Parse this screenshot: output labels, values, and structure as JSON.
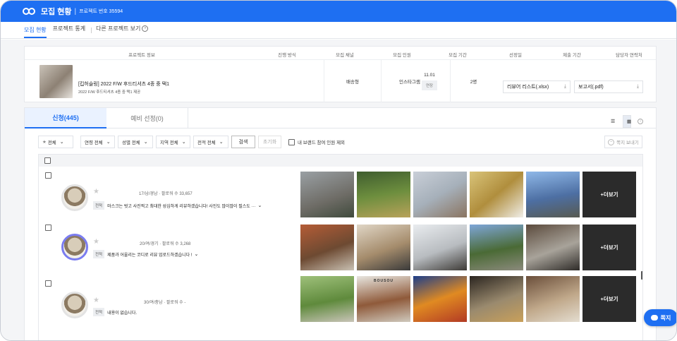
{
  "header": {
    "title": "모집 현황",
    "separator": "|",
    "project_number": "프로젝트 번호 35594"
  },
  "subtabs": [
    {
      "label": "모집 현황",
      "active": true
    },
    {
      "label": "프로젝트 통계",
      "active": false
    },
    {
      "label": "다른 프로젝트 보기",
      "active": false
    }
  ],
  "project_table": {
    "headers": [
      "프로젝트 정보",
      "진행 방식",
      "모집 채널",
      "모집 인원",
      "모집 기간",
      "선정일",
      "제출 기간",
      "담당자 연락처"
    ],
    "name": "[킵허슬링] 2022 F/W 후드티셔츠 4종 중 택1",
    "subtitle": "2022 F/W 후드티셔츠 4종 중 택1 제공",
    "method": "배송형",
    "channel": "인스타그램",
    "recruit_date": "11.01",
    "recruit_status": "연장",
    "recruit_count": "2명",
    "downloads": [
      {
        "label": "리뷰어 리스트(.xlsx)",
        "icon": "download-icon"
      },
      {
        "label": "보고서(.pdf)",
        "icon": "download-icon"
      }
    ]
  },
  "list_tabs": [
    {
      "label": "신청(445)",
      "active": true
    },
    {
      "label": "예비 선정(0)",
      "active": false
    }
  ],
  "view_icons": [
    "list-view-icon",
    "grid-view-icon",
    "info-icon"
  ],
  "filters": {
    "star": "전체",
    "age": "연령 전체",
    "gender": "성별 전체",
    "region": "지역 전체",
    "career": "전적 전체",
    "search_label": "검색",
    "reset_label": "초기화",
    "exclude_label": "내 브랜드 참여 인원 제외",
    "send_message": "쪽지 보내기"
  },
  "applicants": [
    {
      "meta": "17/남/경남 · 팔로워 수 33,657",
      "tag": "전적",
      "review": "마스크는 벗고 사진찍고 최대한 성심하게 리뷰하겠습니다! 사진도 많이많이 필스도 ···",
      "more_label": "+더보기"
    },
    {
      "meta": "20/여/경기 · 팔로워 수 3,268",
      "tag": "전적",
      "review": "제품과 어울리는 코디로 리뷰 업로드하겠습니다 !",
      "more_label": "+더보기"
    },
    {
      "meta": "30/여/충남 · 팔로워 수 -",
      "tag": "전적",
      "review": "내용이 없습니다.",
      "photo_text": "BOUSOU",
      "more_label": "+더보기"
    }
  ],
  "chat_button": {
    "label": "쪽지"
  },
  "colors": {
    "accent": "#1e6ff2",
    "active_tab_bg": "#eaf2ff",
    "more_overlay": "#2b2b2b"
  }
}
